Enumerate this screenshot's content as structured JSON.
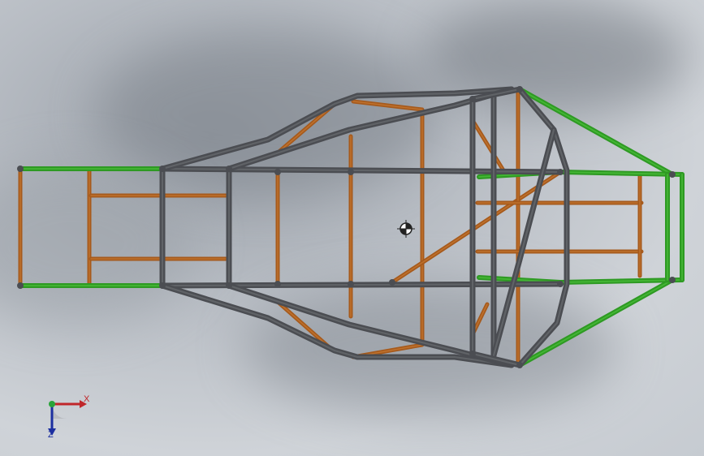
{
  "viewport": {
    "colors": {
      "frame_tube": "#4b4d52",
      "frame_tube_highlight": "#6a6c71",
      "cross_member": "#a65a1c",
      "cross_member_highlight": "#c97a35",
      "bumper_tube": "#2e9a23",
      "bumper_tube_highlight": "#4fc23d",
      "background_light": "#cfd3d8",
      "background_dark": "#8e949b"
    },
    "model": "tube-frame-chassis",
    "view": "top"
  },
  "triad": {
    "x_label": "X",
    "z_label": "Z",
    "x_color": "#c0262a",
    "y_color": "#29a33a",
    "z_color": "#1c2fa0"
  },
  "center_of_mass_icon": "center-of-mass-icon"
}
